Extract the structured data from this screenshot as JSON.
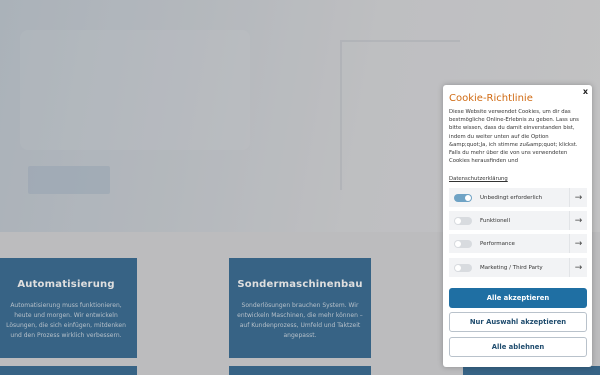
{
  "cards": [
    {
      "title": "Automatisierung",
      "text": "Automatisierung muss funktionieren, heute und morgen. Wir entwickeln Lösungen, die sich einfügen, mitdenken und den Prozess wirklich verbessern."
    },
    {
      "title": "Sondermaschinenbau",
      "text": "Sonderlösungen brauchen System. Wir entwickeln Maschinen, die mehr können – auf Kundenprozess, Umfeld und Taktzeit angepasst."
    }
  ],
  "cookie": {
    "close_label": "x",
    "title": "Cookie-Richtlinie",
    "text": "Diese Website verwendet Cookies, um dir das bestmögliche Online-Erlebnis zu geben. Lass uns bitte wissen, dass du damit einverstanden bist, indem du weiter unten auf die Option &amp;quot;Ja, ich stimme zu&amp;quot; klickst. Falls du mehr über die von uns verwendeten Cookies herausfinden und",
    "privacy_link": "Datenschutzerklärung",
    "options": [
      {
        "label": "Unbedingt erforderlich",
        "enabled": true,
        "arrow": "→"
      },
      {
        "label": "Funktionell",
        "enabled": false,
        "arrow": "→"
      },
      {
        "label": "Performance",
        "enabled": false,
        "arrow": "→"
      },
      {
        "label": "Marketing / Third Party",
        "enabled": false,
        "arrow": "→"
      }
    ],
    "accept_all": "Alle akzeptieren",
    "accept_selection": "Nur Auswahl akzeptieren",
    "reject_all": "Alle ablehnen"
  },
  "colors": {
    "card_blue": "#1f5a87",
    "title_orange": "#d06a12",
    "button_blue": "#1f6fa3",
    "toggle_on": "#6fa3c5"
  }
}
